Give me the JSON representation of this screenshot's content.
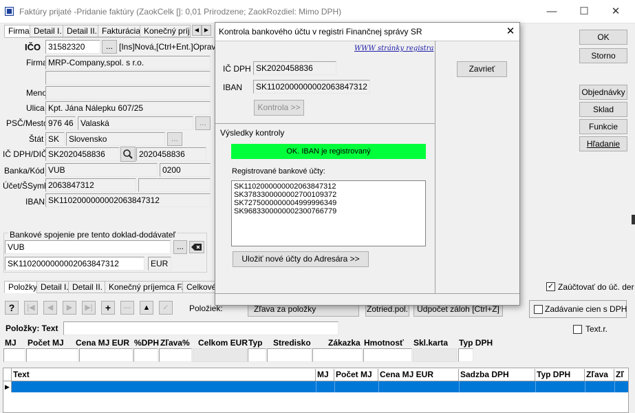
{
  "window": {
    "title": "Faktúry prijaté -Pridanie faktúry  (ZaokCelk []: 0,01 Prirodzene; ZaokRozdiel: Mimo DPH)",
    "minimize": "—",
    "maximize": "☐",
    "close": "✕"
  },
  "main_tabs": [
    "Firma",
    "Detail I.",
    "Detail II.",
    "Fakturácia",
    "Konečný príj."
  ],
  "form": {
    "ico_label": "IČO",
    "ico_value": "31582320",
    "ico_btn": "...",
    "ico_hint": "[Ins]Nová,[Ctrl+Ent.]Oprava",
    "firma_label": "Firma",
    "firma_value": "MRP-Company,spol. s r.o.",
    "firma_value2": "",
    "meno_label": "Meno",
    "meno_value": "",
    "ulica_label": "Ulica",
    "ulica_value": "Kpt. Jána Nálepku 607/25",
    "psc_label": "PSČ/Mesto",
    "psc_value": "976 46",
    "mesto_value": "Valaská",
    "stat_label": "Štát",
    "stat_code": "SK",
    "stat_name": "Slovensko",
    "icdph_label": "IČ DPH/DIČ",
    "icdph_value": "SK2020458836",
    "dic_value": "2020458836",
    "banka_label": "Banka/Kód",
    "banka_value": "VUB",
    "banka_kod": "0200",
    "ucet_label": "Účet/ŠSymb",
    "ucet_value": "2063847312",
    "ssymb_value": "",
    "iban_label": "IBAN",
    "iban_value": "SK1102000000002063847312"
  },
  "bank_group": {
    "title": "Bankové spojenie pre tento doklad-dodávateľ",
    "bank": "VUB",
    "iban": "SK1102000000002063847312",
    "currency": "EUR"
  },
  "right_buttons": [
    "OK",
    "Storno",
    "Objednávky",
    "Sklad",
    "Funkcie",
    "Hľadanie"
  ],
  "dialog": {
    "title": "Kontrola bankového účtu v registri Finančnej správy SR",
    "link": "WWW stránky registra",
    "icdph_label": "IČ DPH",
    "icdph_value": "SK2020458836",
    "iban_label": "IBAN",
    "iban_value": "SK1102000000002063847312",
    "kontrola_btn": "Kontrola >>",
    "results_label": "Výsledky kontroly",
    "status": "OK. IBAN je registrovaný",
    "status_color": "#00ff3b",
    "registered_label": "Registrované bankové účty:",
    "accounts": [
      "SK1102000000002063847312",
      "SK3783300000002700109372",
      "SK7275000000004999996349",
      "SK9683300000002300766779"
    ],
    "save_btn": "Uložiť nové účty do Adresára >>",
    "close_btn": "Zavrieť"
  },
  "items_tabs": [
    "Položky",
    "Detail I.",
    "Detail II.",
    "Konečný príjemca FA",
    "Celkové"
  ],
  "zauctovat_label": "Zaúčtovať do úč. der",
  "toolbar": {
    "help": "?",
    "polozek_label": "Položiek:",
    "zrava_btn": "Zľava za položky",
    "zotried_btn": "Zotried.pol.",
    "udpocet_btn": "Udpočet záloh [Ctrl+Z]",
    "zadavanie_label": "Zadávanie cien s DPH"
  },
  "item_text_label": "Položky: Text",
  "textr_label": "Text.r.",
  "item_columns": [
    "MJ",
    "Počet MJ",
    "Cena MJ EUR",
    "%DPH",
    "Zľava%",
    "Celkom EUR",
    "Typ",
    "Stredisko",
    "Zákazka",
    "Hmotnosť",
    "Skl.karta",
    "Typ DPH"
  ],
  "grid_columns": [
    "Text",
    "MJ",
    "Počet MJ",
    "Cena MJ EUR",
    "Sadzba DPH",
    "Typ DPH",
    "Zľava",
    "Zľ"
  ],
  "accent_color": "#0078d7"
}
